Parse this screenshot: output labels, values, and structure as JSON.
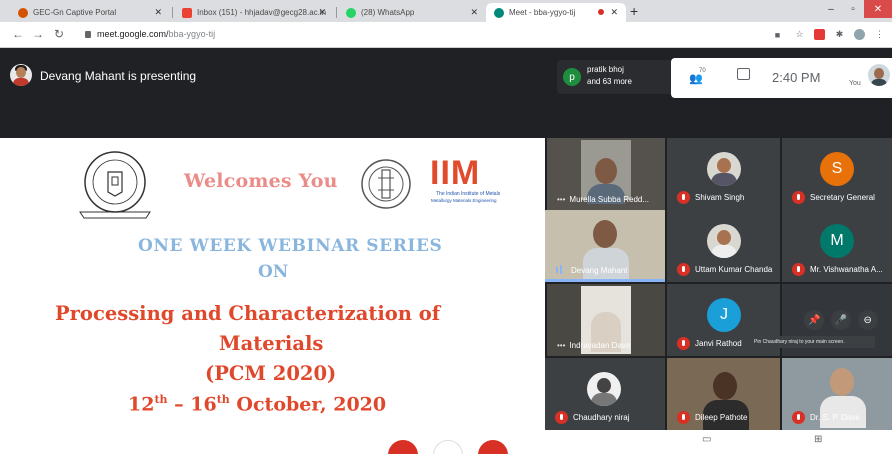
{
  "browser": {
    "tabs": [
      {
        "title": "GEC-Gn Captive Portal",
        "favicon_color": "#d35400"
      },
      {
        "title": "Inbox (151) - hhjadav@gecg28.ac.in",
        "favicon_color": "#ea4335"
      },
      {
        "title": "(28) WhatsApp",
        "favicon_color": "#25d366"
      },
      {
        "title": "Meet - bba-ygyo-tij",
        "favicon_color": "#00897b"
      }
    ],
    "new_tab": "+",
    "url_host": "meet.google.com/",
    "url_path": "bba-ygyo-tij"
  },
  "meet": {
    "presenter_text": "Devang Mahant is presenting",
    "people_pill": {
      "initial": "p",
      "line1": "pratik bhoj",
      "line2": "and 63 more"
    },
    "participant_count": "70",
    "time": "2:40 PM",
    "you_label": "You"
  },
  "slide": {
    "welcome": "Welcomes You",
    "iim": "IIM",
    "iim_sub1": "The Indian Institute of Metals",
    "iim_sub2": "Metallurgy Materials Engineering",
    "series": "ONE WEEK WEBINAR SERIES",
    "on": "ON",
    "title_line1": "Processing and Characterization of",
    "title_line2": "Materials",
    "title_line3": "(PCM 2020)",
    "date_day1": "12",
    "date_sup1": "th",
    "date_sep": " – 16",
    "date_sup2": "th",
    "date_rest": " October, 2020",
    "seal_top_text": "ENGINEERING",
    "seal_left_text": "GOVERNMENT",
    "seal_right_text": "COLLEGE",
    "seal_bottom_text": "GANDHINAGAR"
  },
  "participants": [
    {
      "name": "Murella Subba Redd...",
      "state": "more"
    },
    {
      "name": "Shivam Singh",
      "state": "muted"
    },
    {
      "name": "Secretary General",
      "state": "muted",
      "initial": "S",
      "color": "#e8710a"
    },
    {
      "name": "Devang Mahant",
      "state": "speaking"
    },
    {
      "name": "Uttam Kumar Chanda",
      "state": "muted"
    },
    {
      "name": "Mr. Vishwanatha A...",
      "state": "muted",
      "initial": "M",
      "color": "#00796b"
    },
    {
      "name": "Indravadan Dave",
      "state": "more"
    },
    {
      "name": "Janvi Rathod",
      "state": "muted",
      "initial": "J",
      "color": "#1a9fd9"
    },
    {
      "name": "Chaudhary niraj",
      "state": "muted"
    },
    {
      "name": "Dileep Pathote",
      "state": "muted"
    },
    {
      "name": "Dr. S. P. Dave",
      "state": "muted"
    }
  ],
  "tooltip": "Pin Chaudhary niraj to your main screen."
}
